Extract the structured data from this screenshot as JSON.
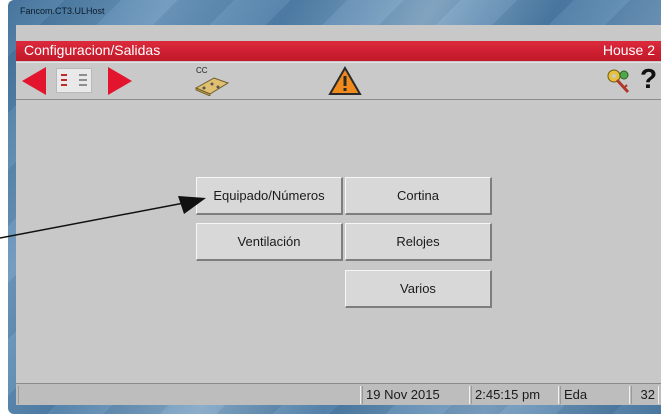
{
  "window": {
    "title": "Fancom.CT3.ULHost"
  },
  "header": {
    "section": "Configuracion/Salidas",
    "house": "House 2"
  },
  "toolbar": {
    "items": [
      {
        "name": "prev-arrow-icon"
      },
      {
        "name": "list-icon"
      },
      {
        "name": "next-arrow-icon"
      },
      {
        "name": "cc-tool-icon",
        "label": "CC"
      },
      {
        "name": "warning-icon",
        "symbol": "!"
      },
      {
        "name": "key-icon"
      },
      {
        "name": "help-icon",
        "label": "?"
      }
    ]
  },
  "menu": {
    "equipado": "Equipado/Números",
    "cortina": "Cortina",
    "ventilacion": "Ventilación",
    "relojes": "Relojes",
    "varios": "Varios"
  },
  "status": {
    "date": "19 Nov 2015",
    "time": "2:45:15 pm",
    "user": "Eda",
    "number": "32"
  },
  "colors": {
    "header_red": "#d42234",
    "arrow_red": "#e3142e",
    "client_gray": "#c8c8c8",
    "warning_orange": "#f08a1c"
  }
}
